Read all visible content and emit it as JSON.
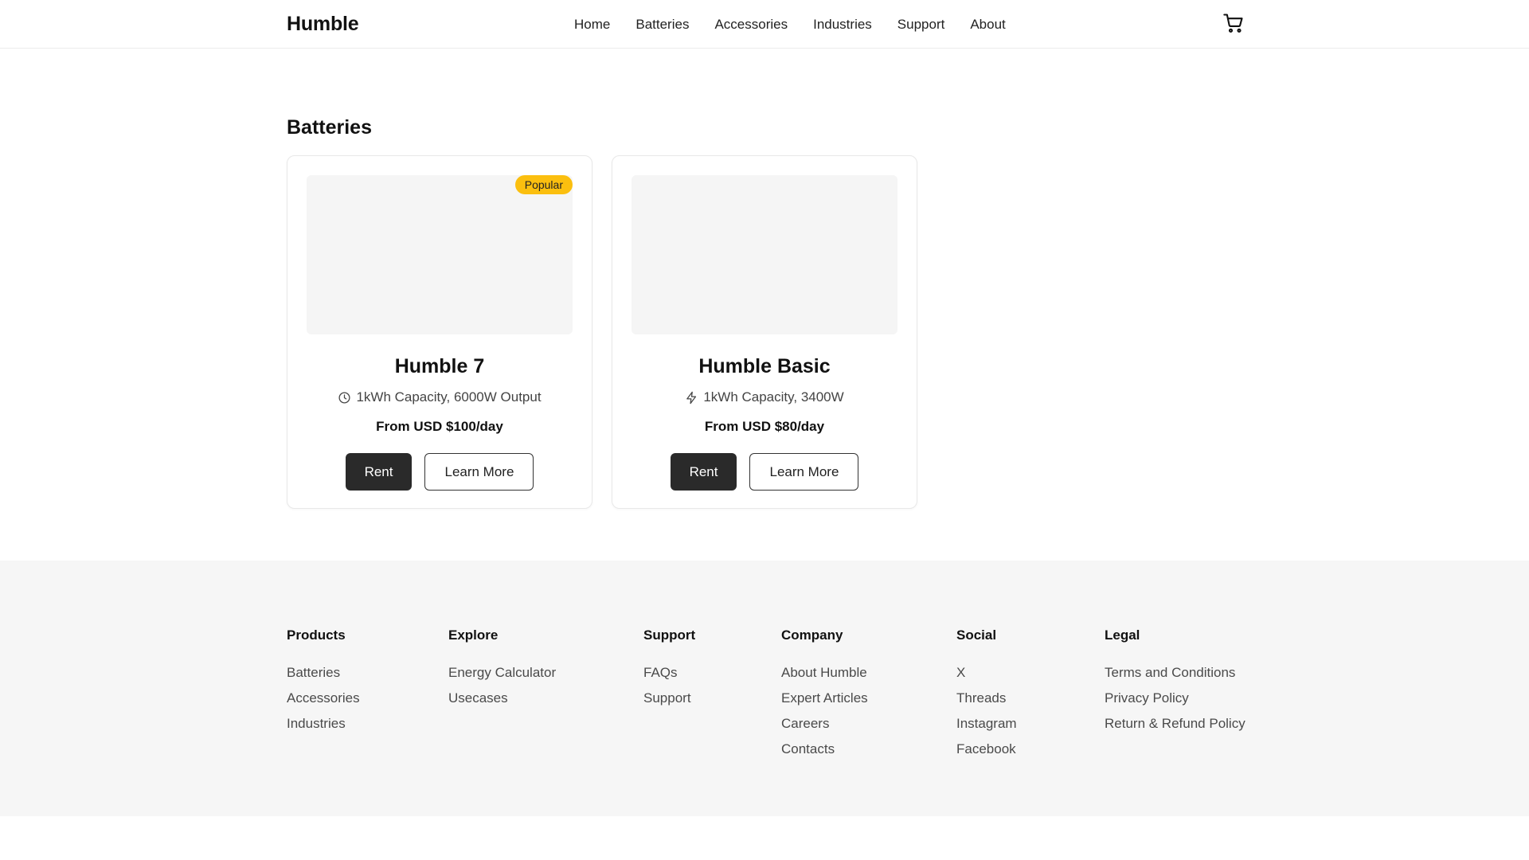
{
  "header": {
    "logo": "Humble",
    "nav": [
      "Home",
      "Batteries",
      "Accessories",
      "Industries",
      "Support",
      "About"
    ],
    "cart_icon": "shopping-cart-icon"
  },
  "main": {
    "section_title": "Batteries",
    "products": [
      {
        "name": "Humble 7",
        "badge": "Popular",
        "spec": "1kWh Capacity, 6000W Output",
        "spec_icon": "clock-icon",
        "price": "From USD $100/day",
        "rent_label": "Rent",
        "learn_label": "Learn More"
      },
      {
        "name": "Humble Basic",
        "spec": "1kWh Capacity, 3400W",
        "spec_icon": "lightning-icon",
        "price": "From USD $80/day",
        "rent_label": "Rent",
        "learn_label": "Learn More"
      }
    ],
    "badge_color": "#fbbf0f"
  },
  "footer": {
    "columns": [
      {
        "title": "Products",
        "links": [
          "Batteries",
          "Accessories",
          "Industries"
        ]
      },
      {
        "title": "Explore",
        "links": [
          "Energy Calculator",
          "Usecases"
        ]
      },
      {
        "title": "Support",
        "links": [
          "FAQs",
          "Support"
        ]
      },
      {
        "title": "Company",
        "links": [
          "About Humble",
          "Expert Articles",
          "Careers",
          "Contacts"
        ]
      },
      {
        "title": "Social",
        "links": [
          "X",
          "Threads",
          "Instagram",
          "Facebook"
        ]
      },
      {
        "title": "Legal",
        "links": [
          "Terms and Conditions",
          "Privacy Policy",
          "Return & Refund Policy"
        ]
      }
    ]
  }
}
